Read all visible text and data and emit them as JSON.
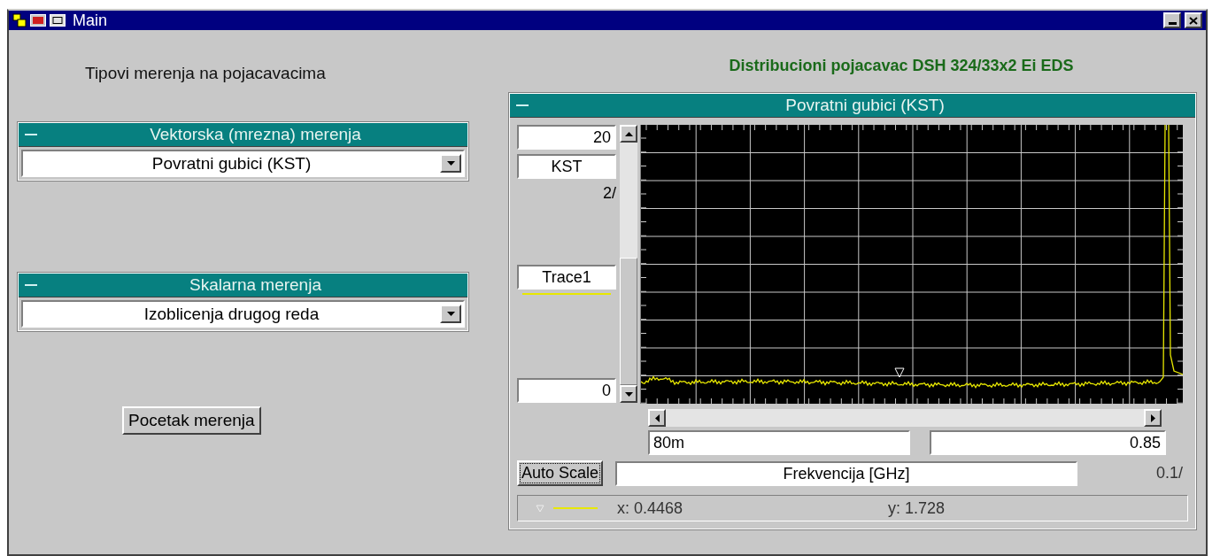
{
  "window": {
    "title": "Main"
  },
  "heading": "Tipovi merenja na pojacavacima",
  "device_title": "Distribucioni pojacavac DSH 324/33x2 Ei EDS",
  "groups": [
    {
      "title": "Vektorska (mrezna) merenja",
      "value": "Povratni gubici (KST)"
    },
    {
      "title": "Skalarna merenja",
      "value": "Izoblicenja drugog reda"
    }
  ],
  "start_button": "Pocetak merenja",
  "graph": {
    "title": "Povratni gubici (KST)",
    "y_max": "20",
    "y_label": "KST",
    "y_step": "2/",
    "trace": "Trace1",
    "y_min": "0",
    "x_min": "80m",
    "x_max": "0.85",
    "auto_scale": "Auto Scale",
    "x_label": "Frekvencija [GHz]",
    "x_step": "0.1/",
    "cursor_x": "x: 0.4468",
    "cursor_y": "y: 1.728"
  }
}
